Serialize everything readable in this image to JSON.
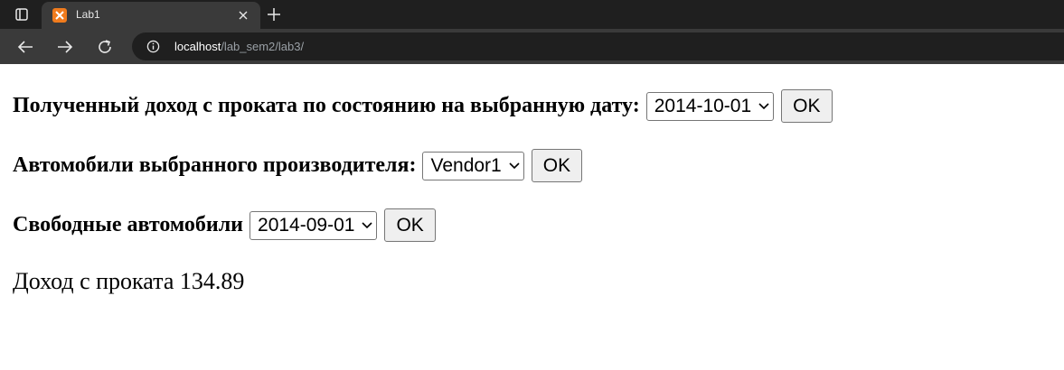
{
  "browser": {
    "tab_title": "Lab1",
    "url_host": "localhost",
    "url_path": "/lab_sem2/lab3/"
  },
  "forms": [
    {
      "label": "Полученный доход с проката по состоянию на выбранную дату:",
      "selected": "2014-10-01",
      "button": "OK"
    },
    {
      "label": "Автомобили выбранного производителя:",
      "selected": "Vendor1",
      "button": "OK"
    },
    {
      "label": "Свободные автомобили",
      "selected": "2014-09-01",
      "button": "OK"
    }
  ],
  "result": {
    "text": "Доход с проката 134.89"
  },
  "colors": {
    "tabbar_bg": "#1f1f1f",
    "toolbar_bg": "#3a3a3a",
    "favicon": "#f07b1d"
  }
}
